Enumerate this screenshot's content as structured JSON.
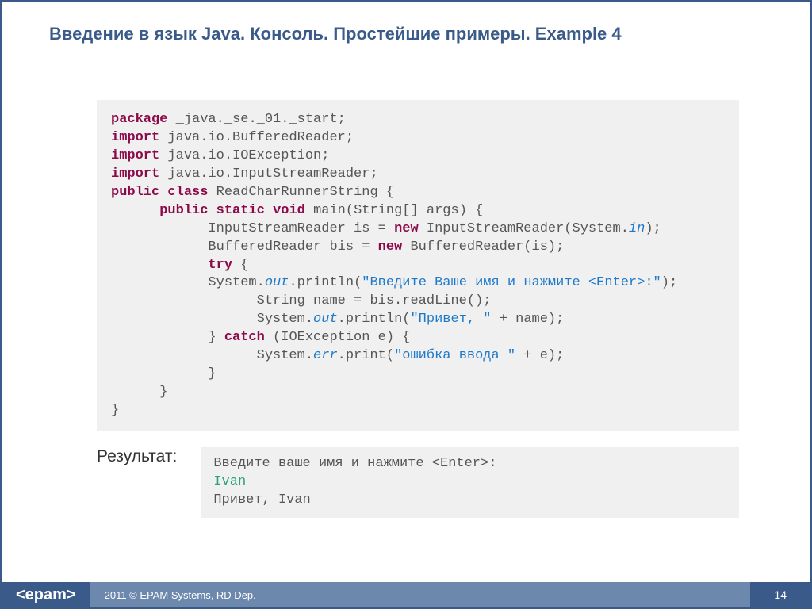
{
  "title": "Введение в язык Java. Консоль. Простейшие примеры. Example 4",
  "code": {
    "l1a": "package",
    "l1b": " _java._se._01._start;",
    "l2a": "import",
    "l2b": " java.io.BufferedReader;",
    "l3a": "import",
    "l3b": " java.io.IOException;",
    "l4a": "import",
    "l4b": " java.io.InputStreamReader;",
    "l5a": "public",
    "l5b": "class",
    "l5c": " ReadCharRunnerString {",
    "l6a": "public",
    "l6b": "static",
    "l6c": "void",
    "l6d": " main(String[] args) {",
    "l7a": "            InputStreamReader is = ",
    "l7b": "new",
    "l7c": " InputStreamReader(System.",
    "l7d": "in",
    "l7e": ");",
    "l8a": "            BufferedReader bis = ",
    "l8b": "new",
    "l8c": " BufferedReader(is);",
    "l9a": "try",
    "l9b": " {",
    "l10a": "            System.",
    "l10b": "out",
    "l10c": ".println(",
    "l10d": "\"Введите Ваше имя и нажмите <Enter>:\"",
    "l10e": ");",
    "l11": "                  String name = bis.readLine();",
    "l12a": "                  System.",
    "l12b": "out",
    "l12c": ".println(",
    "l12d": "\"Привет, \"",
    "l12e": " + name);",
    "l13a": "            } ",
    "l13b": "catch",
    "l13c": " (IOException e) {",
    "l14a": "                  System.",
    "l14b": "err",
    "l14c": ".print(",
    "l14d": "\"ошибка ввода \"",
    "l14e": " + e);",
    "l15": "            }",
    "l16": "      }",
    "l17": "}"
  },
  "result_label": "Результат:",
  "output": {
    "l1": "Введите ваше имя и нажмите <Enter>:",
    "l2": "Ivan",
    "l3": "Привет, Ivan"
  },
  "footer": {
    "logo": "<epam>",
    "copyright": "2011 © EPAM Systems, RD Dep.",
    "page": "14"
  }
}
